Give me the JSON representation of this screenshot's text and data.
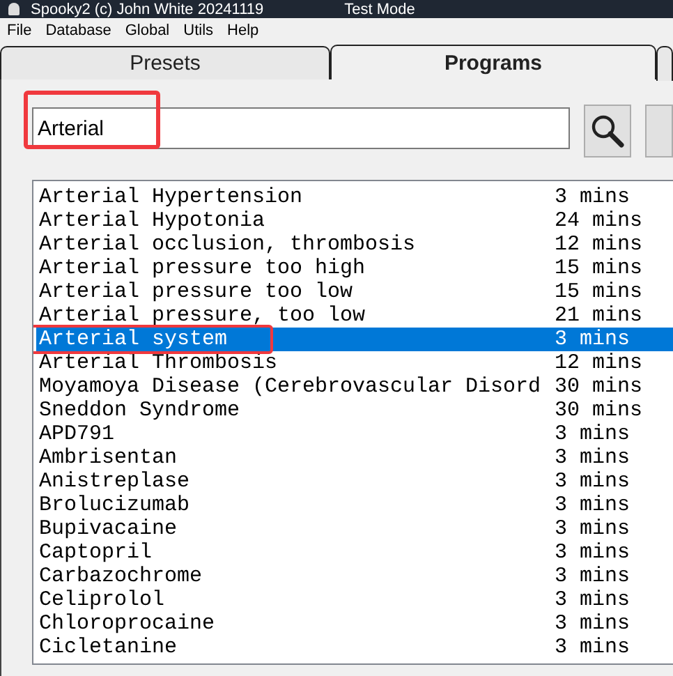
{
  "window": {
    "title": "Spooky2 (c) John White 20241119",
    "mode": "Test Mode"
  },
  "menu": [
    "File",
    "Database",
    "Global",
    "Utils",
    "Help"
  ],
  "tabs": [
    {
      "label": "Presets",
      "selected": false
    },
    {
      "label": "Programs",
      "selected": true
    }
  ],
  "search": {
    "value": "Arterial",
    "highlighted": true
  },
  "programs": [
    {
      "name": "Arterial Hypertension",
      "duration": "3 mins",
      "selected": false,
      "highlighted": false
    },
    {
      "name": "Arterial Hypotonia",
      "duration": "24 mins",
      "selected": false,
      "highlighted": false
    },
    {
      "name": "Arterial occlusion, thrombosis",
      "duration": "12 mins",
      "selected": false,
      "highlighted": false
    },
    {
      "name": "Arterial pressure too high",
      "duration": "15 mins",
      "selected": false,
      "highlighted": false
    },
    {
      "name": "Arterial pressure too low",
      "duration": "15 mins",
      "selected": false,
      "highlighted": false
    },
    {
      "name": "Arterial pressure, too low",
      "duration": "21 mins",
      "selected": false,
      "highlighted": false
    },
    {
      "name": "Arterial system",
      "duration": "3 mins",
      "selected": true,
      "highlighted": true
    },
    {
      "name": "Arterial Thrombosis",
      "duration": "12 mins",
      "selected": false,
      "highlighted": false
    },
    {
      "name": "Moyamoya Disease (Cerebrovascular Disord",
      "duration": "30 mins",
      "selected": false,
      "highlighted": false
    },
    {
      "name": "Sneddon Syndrome",
      "duration": "30 mins",
      "selected": false,
      "highlighted": false
    },
    {
      "name": "APD791",
      "duration": "3 mins",
      "selected": false,
      "highlighted": false
    },
    {
      "name": "Ambrisentan",
      "duration": "3 mins",
      "selected": false,
      "highlighted": false
    },
    {
      "name": "Anistreplase",
      "duration": "3 mins",
      "selected": false,
      "highlighted": false
    },
    {
      "name": "Brolucizumab",
      "duration": "3 mins",
      "selected": false,
      "highlighted": false
    },
    {
      "name": "Bupivacaine",
      "duration": "3 mins",
      "selected": false,
      "highlighted": false
    },
    {
      "name": "Captopril",
      "duration": "3 mins",
      "selected": false,
      "highlighted": false
    },
    {
      "name": "Carbazochrome",
      "duration": "3 mins",
      "selected": false,
      "highlighted": false
    },
    {
      "name": "Celiprolol",
      "duration": "3 mins",
      "selected": false,
      "highlighted": false
    },
    {
      "name": "Chloroprocaine",
      "duration": "3 mins",
      "selected": false,
      "highlighted": false
    },
    {
      "name": "Cicletanine",
      "duration": "3 mins",
      "selected": false,
      "highlighted": false
    }
  ]
}
